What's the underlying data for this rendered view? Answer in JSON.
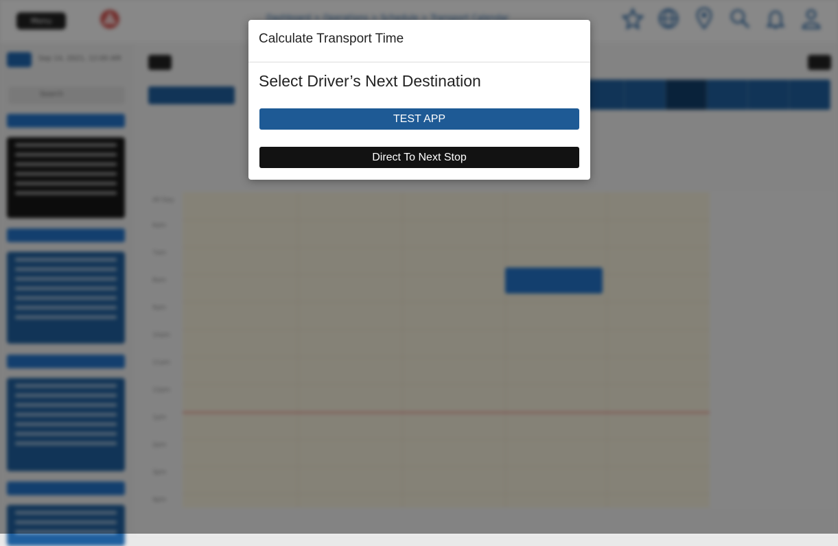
{
  "background": {
    "menu_label": "Menu",
    "breadcrumb": "Dashboard > Operations > Schedule > Transport Calendar",
    "sidebar_search": "Search",
    "sidebar_date": "Sep 14, 2021, 12:00 AM",
    "top_icons": [
      "star-icon",
      "globe-icon",
      "location-pin-icon",
      "search-icon",
      "bell-icon",
      "user-icon"
    ],
    "time_labels": [
      "All Day",
      "6am",
      "7am",
      "8am",
      "9am",
      "10am",
      "11am",
      "12pm",
      "1pm",
      "2pm",
      "3pm",
      "4pm"
    ],
    "colors": {
      "primary": "#1e5a95",
      "accent_blue": "#2373c8",
      "dark": "#121212",
      "calendar_bg": "#f3edd9",
      "now_line": "#e8a7a0"
    }
  },
  "modal": {
    "title": "Calculate Transport Time",
    "heading": "Select Driver’s Next Destination",
    "options": [
      {
        "label": "TEST APP",
        "color": "#1e5a95"
      },
      {
        "label": "Direct To Next Stop",
        "color": "#121212"
      }
    ]
  }
}
